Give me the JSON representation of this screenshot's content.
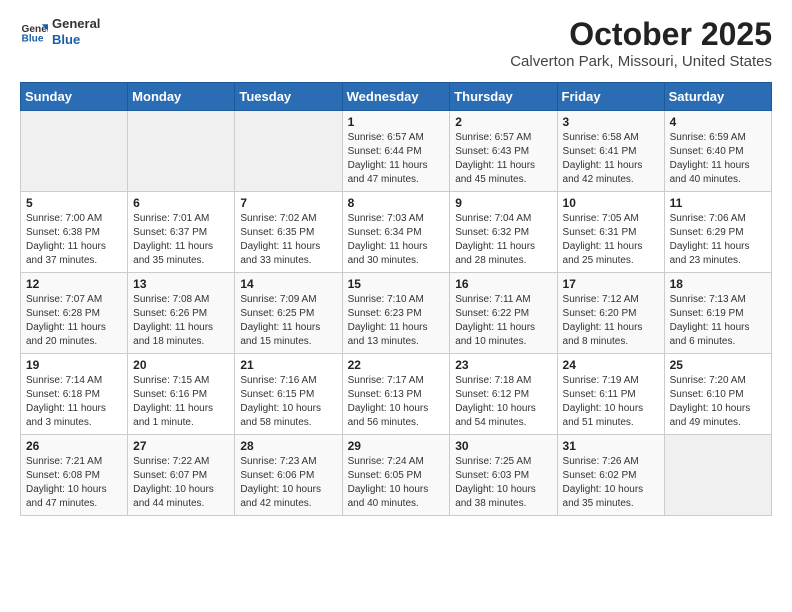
{
  "logo": {
    "general": "General",
    "blue": "Blue"
  },
  "header": {
    "month": "October 2025",
    "location": "Calverton Park, Missouri, United States"
  },
  "weekdays": [
    "Sunday",
    "Monday",
    "Tuesday",
    "Wednesday",
    "Thursday",
    "Friday",
    "Saturday"
  ],
  "weeks": [
    [
      {
        "day": "",
        "info": ""
      },
      {
        "day": "",
        "info": ""
      },
      {
        "day": "",
        "info": ""
      },
      {
        "day": "1",
        "info": "Sunrise: 6:57 AM\nSunset: 6:44 PM\nDaylight: 11 hours and 47 minutes."
      },
      {
        "day": "2",
        "info": "Sunrise: 6:57 AM\nSunset: 6:43 PM\nDaylight: 11 hours and 45 minutes."
      },
      {
        "day": "3",
        "info": "Sunrise: 6:58 AM\nSunset: 6:41 PM\nDaylight: 11 hours and 42 minutes."
      },
      {
        "day": "4",
        "info": "Sunrise: 6:59 AM\nSunset: 6:40 PM\nDaylight: 11 hours and 40 minutes."
      }
    ],
    [
      {
        "day": "5",
        "info": "Sunrise: 7:00 AM\nSunset: 6:38 PM\nDaylight: 11 hours and 37 minutes."
      },
      {
        "day": "6",
        "info": "Sunrise: 7:01 AM\nSunset: 6:37 PM\nDaylight: 11 hours and 35 minutes."
      },
      {
        "day": "7",
        "info": "Sunrise: 7:02 AM\nSunset: 6:35 PM\nDaylight: 11 hours and 33 minutes."
      },
      {
        "day": "8",
        "info": "Sunrise: 7:03 AM\nSunset: 6:34 PM\nDaylight: 11 hours and 30 minutes."
      },
      {
        "day": "9",
        "info": "Sunrise: 7:04 AM\nSunset: 6:32 PM\nDaylight: 11 hours and 28 minutes."
      },
      {
        "day": "10",
        "info": "Sunrise: 7:05 AM\nSunset: 6:31 PM\nDaylight: 11 hours and 25 minutes."
      },
      {
        "day": "11",
        "info": "Sunrise: 7:06 AM\nSunset: 6:29 PM\nDaylight: 11 hours and 23 minutes."
      }
    ],
    [
      {
        "day": "12",
        "info": "Sunrise: 7:07 AM\nSunset: 6:28 PM\nDaylight: 11 hours and 20 minutes."
      },
      {
        "day": "13",
        "info": "Sunrise: 7:08 AM\nSunset: 6:26 PM\nDaylight: 11 hours and 18 minutes."
      },
      {
        "day": "14",
        "info": "Sunrise: 7:09 AM\nSunset: 6:25 PM\nDaylight: 11 hours and 15 minutes."
      },
      {
        "day": "15",
        "info": "Sunrise: 7:10 AM\nSunset: 6:23 PM\nDaylight: 11 hours and 13 minutes."
      },
      {
        "day": "16",
        "info": "Sunrise: 7:11 AM\nSunset: 6:22 PM\nDaylight: 11 hours and 10 minutes."
      },
      {
        "day": "17",
        "info": "Sunrise: 7:12 AM\nSunset: 6:20 PM\nDaylight: 11 hours and 8 minutes."
      },
      {
        "day": "18",
        "info": "Sunrise: 7:13 AM\nSunset: 6:19 PM\nDaylight: 11 hours and 6 minutes."
      }
    ],
    [
      {
        "day": "19",
        "info": "Sunrise: 7:14 AM\nSunset: 6:18 PM\nDaylight: 11 hours and 3 minutes."
      },
      {
        "day": "20",
        "info": "Sunrise: 7:15 AM\nSunset: 6:16 PM\nDaylight: 11 hours and 1 minute."
      },
      {
        "day": "21",
        "info": "Sunrise: 7:16 AM\nSunset: 6:15 PM\nDaylight: 10 hours and 58 minutes."
      },
      {
        "day": "22",
        "info": "Sunrise: 7:17 AM\nSunset: 6:13 PM\nDaylight: 10 hours and 56 minutes."
      },
      {
        "day": "23",
        "info": "Sunrise: 7:18 AM\nSunset: 6:12 PM\nDaylight: 10 hours and 54 minutes."
      },
      {
        "day": "24",
        "info": "Sunrise: 7:19 AM\nSunset: 6:11 PM\nDaylight: 10 hours and 51 minutes."
      },
      {
        "day": "25",
        "info": "Sunrise: 7:20 AM\nSunset: 6:10 PM\nDaylight: 10 hours and 49 minutes."
      }
    ],
    [
      {
        "day": "26",
        "info": "Sunrise: 7:21 AM\nSunset: 6:08 PM\nDaylight: 10 hours and 47 minutes."
      },
      {
        "day": "27",
        "info": "Sunrise: 7:22 AM\nSunset: 6:07 PM\nDaylight: 10 hours and 44 minutes."
      },
      {
        "day": "28",
        "info": "Sunrise: 7:23 AM\nSunset: 6:06 PM\nDaylight: 10 hours and 42 minutes."
      },
      {
        "day": "29",
        "info": "Sunrise: 7:24 AM\nSunset: 6:05 PM\nDaylight: 10 hours and 40 minutes."
      },
      {
        "day": "30",
        "info": "Sunrise: 7:25 AM\nSunset: 6:03 PM\nDaylight: 10 hours and 38 minutes."
      },
      {
        "day": "31",
        "info": "Sunrise: 7:26 AM\nSunset: 6:02 PM\nDaylight: 10 hours and 35 minutes."
      },
      {
        "day": "",
        "info": ""
      }
    ]
  ]
}
